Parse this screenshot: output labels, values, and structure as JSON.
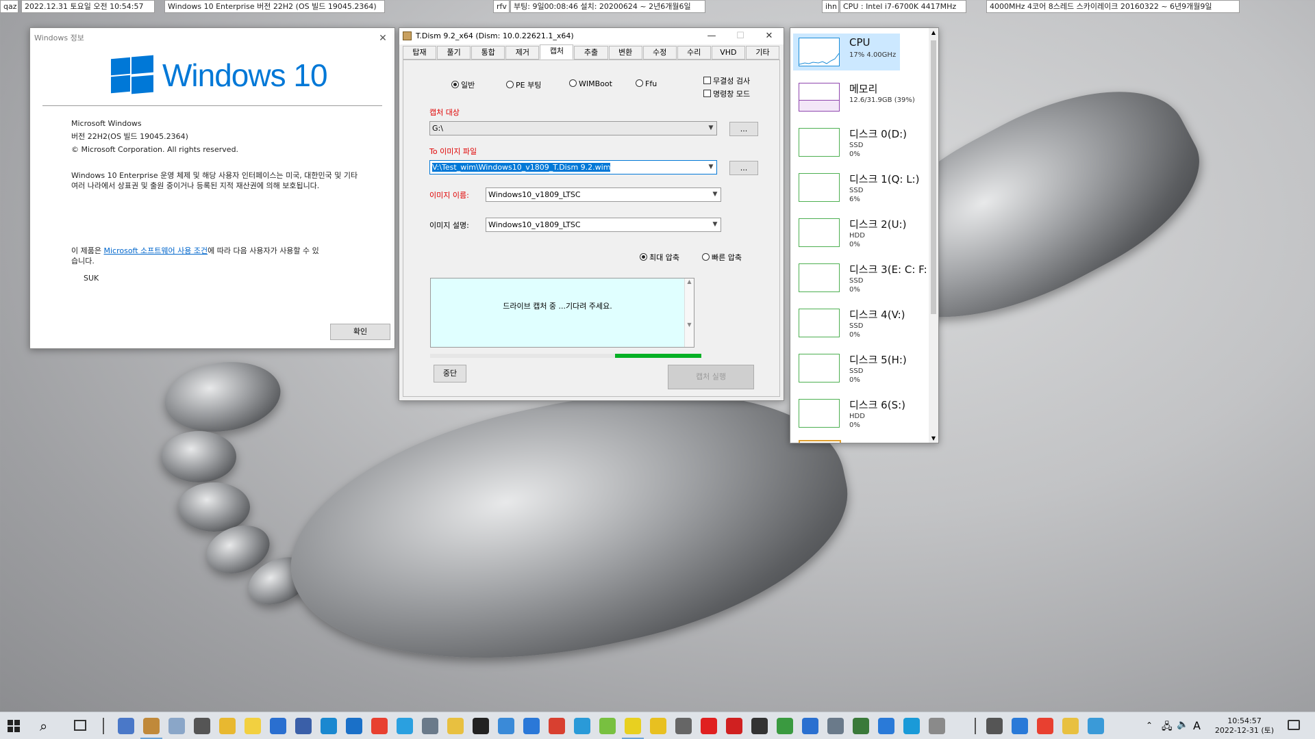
{
  "topbar": {
    "left_tag": "qaz",
    "datetime": "2022.12.31 토요일 오전 10:54:57",
    "os": "Windows 10 Enterprise 버전 22H2 (OS 빌드 19045.2364)",
    "mid_tag": "rfv",
    "boot": "부팅: 9일00:08:46 설치: 20200624 ~ 2년6개월6일",
    "right_tag": "ihn",
    "cpu": "CPU : Intel i7-6700K 4417MHz",
    "cpu2": "4000MHz 4코어 8스레드 스카이레이크 20160322 ~ 6년9개월9일"
  },
  "about": {
    "title": "Windows 정보",
    "brand": "Windows 10",
    "line1": "Microsoft Windows",
    "line2": "버전 22H2(OS 빌드 19045.2364)",
    "line3": "© Microsoft Corporation. All rights reserved.",
    "para1": "Windows 10 Enterprise 운영 체제 및 해당 사용자 인터페이스는 미국, 대한민국 및 기타 여러 나라에서 상표권 및 출원 중이거나 등록된 지적 재산권에 의해 보호됩니다.",
    "license_pre": "이 제품은 ",
    "license_link": "Microsoft 소프트웨어 사용 조건",
    "license_post": "에 따라 다음 사용자가 사용할 수 있습니다.",
    "user": "SUK",
    "ok": "확인"
  },
  "tdism": {
    "title": "T.Dism 9.2_x64   (Dism: 10.0.22621.1_x64)",
    "tabs": [
      "탑재",
      "풀기",
      "통합",
      "제거",
      "캡처",
      "추출",
      "변환",
      "수정",
      "수리",
      "VHD",
      "기타"
    ],
    "selected_tab": "캡처",
    "modes": [
      "일반",
      "PE 부팅",
      "WIMBoot",
      "Ffu"
    ],
    "selected_mode": "일반",
    "checks": [
      "무결성 검사",
      "명령창 모드"
    ],
    "capture_target_label": "캡처 대상",
    "capture_target": "G:\\",
    "to_image_label": "To 이미지 파일",
    "to_image": "V:\\Test_wim\\Windows10_v1809_T.Dism 9.2.wim",
    "image_name_label": "이미지 이름:",
    "image_name": "Windows10_v1809_LTSC",
    "image_desc_label": "이미지 설명:",
    "image_desc": "Windows10_v1809_LTSC",
    "compression": [
      "최대 압축",
      "빠른 압축"
    ],
    "selected_compression": "최대 압축",
    "browse": "...",
    "message": "드라이브 캡처 중 ...기다려 주세요.",
    "progress": 0.33,
    "stop": "중단",
    "run": "캡처 실행"
  },
  "perf": {
    "items": [
      {
        "name": "CPU",
        "sub1": "17% 4.00GHz",
        "sub2": ""
      },
      {
        "name": "메모리",
        "sub1": "12.6/31.9GB (39%)",
        "sub2": ""
      },
      {
        "name": "디스크 0(D:)",
        "sub1": "SSD",
        "sub2": "0%"
      },
      {
        "name": "디스크 1(Q: L:)",
        "sub1": "SSD",
        "sub2": "6%"
      },
      {
        "name": "디스크 2(U:)",
        "sub1": "HDD",
        "sub2": "0%"
      },
      {
        "name": "디스크 3(E: C: F:",
        "sub1": "SSD",
        "sub2": "0%"
      },
      {
        "name": "디스크 4(V:)",
        "sub1": "SSD",
        "sub2": "0%"
      },
      {
        "name": "디스크 5(H:)",
        "sub1": "SSD",
        "sub2": "0%"
      },
      {
        "name": "디스크 6(S:)",
        "sub1": "HDD",
        "sub2": "0%"
      }
    ]
  },
  "taskbar": {
    "time": "10:54:57",
    "date": "2022-12-31 (토)",
    "ime": "A"
  }
}
